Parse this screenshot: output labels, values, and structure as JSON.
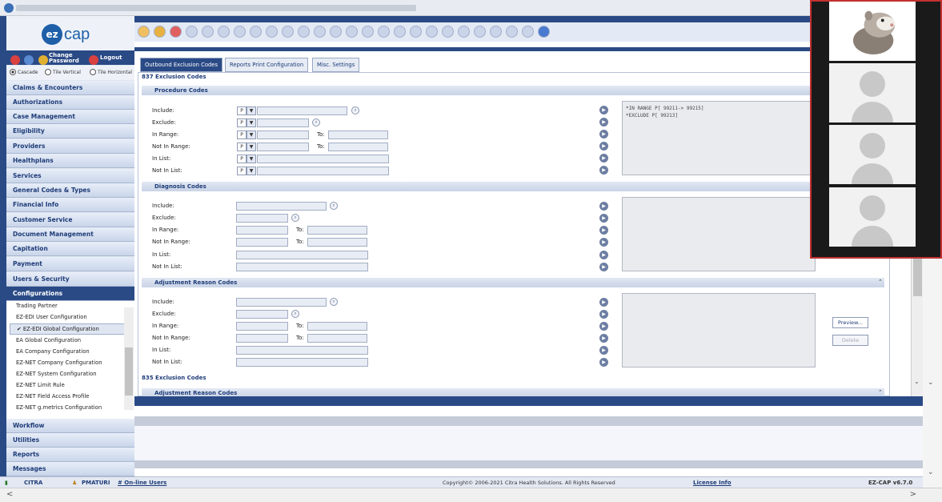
{
  "app": {
    "name": "ez cap",
    "version": "EZ-CAP v6.7.0"
  },
  "header": {
    "change_password": "Change Password",
    "logout": "Logout"
  },
  "layout_options": {
    "cascade": "Cascade",
    "tile_vertical": "Tile Vertical",
    "tile_horizontal": "Tile Horizontal"
  },
  "sidebar": {
    "items": [
      {
        "label": "Claims & Encounters"
      },
      {
        "label": "Authorizations"
      },
      {
        "label": "Case Management"
      },
      {
        "label": "Eligibility"
      },
      {
        "label": "Providers"
      },
      {
        "label": "Healthplans"
      },
      {
        "label": "Services"
      },
      {
        "label": "General Codes & Types"
      },
      {
        "label": "Financial Info"
      },
      {
        "label": "Customer Service"
      },
      {
        "label": "Document Management"
      },
      {
        "label": "Capitation"
      },
      {
        "label": "Payment"
      },
      {
        "label": "Users & Security"
      },
      {
        "label": "Configurations"
      }
    ],
    "config_items": [
      {
        "label": "Trading Partner"
      },
      {
        "label": "EZ-EDI User Configuration"
      },
      {
        "label": "EZ-EDI Global Configuration"
      },
      {
        "label": "EA Global Configuration"
      },
      {
        "label": "EA Company Configuration"
      },
      {
        "label": "EZ-NET Company Configuration"
      },
      {
        "label": "EZ-NET System Configuration"
      },
      {
        "label": "EZ-NET Limit Rule"
      },
      {
        "label": "EZ-NET Field Access Profile"
      },
      {
        "label": "EZ-NET g.metrics Configuration"
      }
    ],
    "bottom_items": [
      {
        "label": "Workflow"
      },
      {
        "label": "Utilities"
      },
      {
        "label": "Reports"
      },
      {
        "label": "Messages"
      }
    ]
  },
  "tabs": [
    {
      "label": "Outbound Exclusion Codes"
    },
    {
      "label": "Reports Print Configuration"
    },
    {
      "label": "Misc. Settings"
    }
  ],
  "main": {
    "section_837": "837 Exclusion Codes",
    "section_835": "835 Exclusion Codes",
    "procedure": {
      "title": "Procedure Codes",
      "labels": [
        "Include:",
        "Exclude:",
        "In Range:",
        "Not In Range:",
        "In List:",
        "Not In List:"
      ],
      "prefix": "P",
      "to_label": "To:",
      "result_text": "*IN RANGE P[ 99211-> 99215]\n*EXCLUDE P[ 99213]"
    },
    "diagnosis": {
      "title": "Diagnosis Codes",
      "labels": [
        "Include:",
        "Exclude:",
        "In Range:",
        "Not In Range:",
        "In List:",
        "Not In List:"
      ],
      "to_label": "To:"
    },
    "adjustment": {
      "title": "Adjustment Reason Codes",
      "labels": [
        "Include:",
        "Exclude:",
        "In Range:",
        "Not In Range:",
        "In List:",
        "Not In List:"
      ],
      "to_label": "To:"
    },
    "adjustment_835": {
      "title": "Adjustment Reason Codes"
    },
    "preview_button": "Preview...",
    "delete_button": "Delete"
  },
  "status": {
    "company": "CITRA",
    "user": "PMATURI",
    "online_users": "# On-line Users",
    "copyright": "Copyright© 2006-2021 Citra Health Solutions. All Rights Reserved",
    "license": "License Info",
    "version": "EZ-CAP v6.7.0"
  },
  "colors": {
    "navy": "#2a4a86",
    "link": "#1e3c78",
    "video_border": "#c23030"
  }
}
